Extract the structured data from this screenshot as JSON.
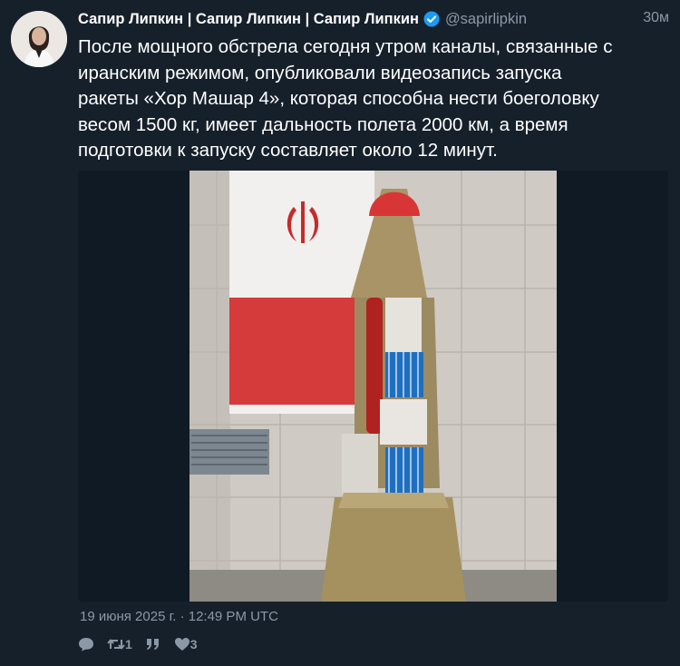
{
  "tweet": {
    "author_name": "Сапир Липкин | Сапир Липкин | Сапир Липкин",
    "handle": "@sapirlipkin",
    "time_ago": "30м",
    "text": "После мощного обстрела сегодня утром каналы, связанные с\nиранским режимом, опубликовали видеозапись запуска\nракеты «Хор Машар 4», которая способна нести боеголовку\nвесом 1500 кг, имеет дальность полета 2000 км, а время\nподготовки к запуску составляет около 12 минут.",
    "timestamp": "19 июня 2025 г. · 12:49 PM UTC",
    "retweet_count": "1",
    "like_count": "3"
  },
  "icons": {
    "verified": "verified-badge-icon",
    "reply": "reply-icon",
    "retweet": "retweet-icon",
    "quote": "quote-icon",
    "like": "heart-icon"
  },
  "colors": {
    "background": "#16202b",
    "verified": "#1d9bf0",
    "muted": "#8b98a5"
  }
}
